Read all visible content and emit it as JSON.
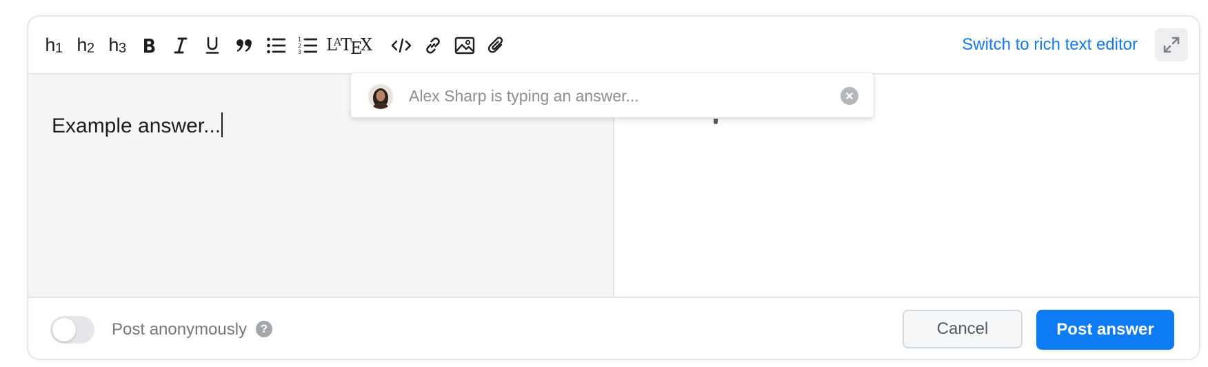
{
  "toolbar": {
    "h1": {
      "base": "h",
      "sub": "1"
    },
    "h2": {
      "base": "h",
      "sub": "2"
    },
    "h3": {
      "base": "h",
      "sub": "3"
    },
    "switch_label": "Switch to rich text editor",
    "icons": [
      "h1",
      "h2",
      "h3",
      "bold-icon",
      "italic-icon",
      "underline-icon",
      "quote-icon",
      "bullet-list-icon",
      "numbered-list-icon",
      "latex-icon",
      "code-icon",
      "link-icon",
      "image-icon",
      "attachment-icon",
      "expand-icon"
    ]
  },
  "editor": {
    "input_text": "Example answer..."
  },
  "typing_indicator": {
    "text": "Alex Sharp is typing an answer..."
  },
  "footer": {
    "anonymous_label": "Post anonymously",
    "anonymous_enabled": false,
    "help_glyph": "?",
    "cancel_label": "Cancel",
    "post_label": "Post answer"
  },
  "colors": {
    "accent": "#0d7bf3",
    "link": "#1478e8",
    "editor_bg": "#f5f5f5",
    "border": "#e3e5e8"
  }
}
